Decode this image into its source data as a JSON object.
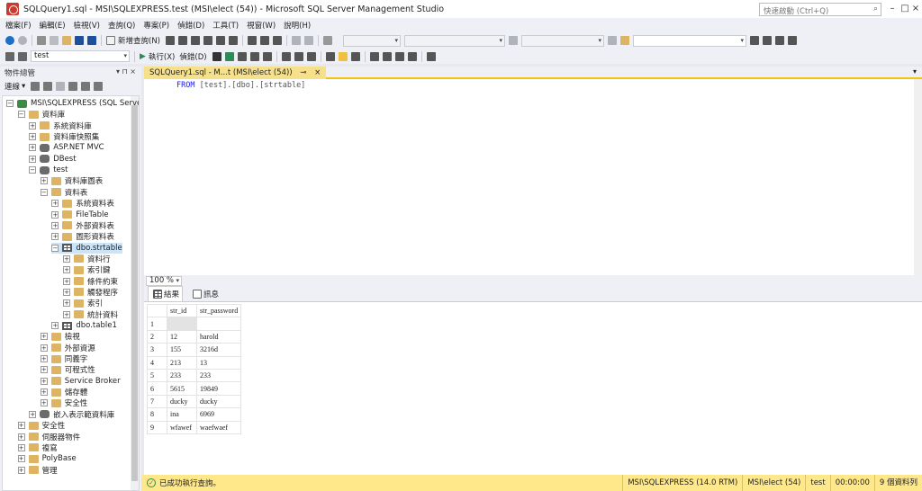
{
  "window": {
    "title": "SQLQuery1.sql - MSI\\SQLEXPRESS.test (MSI\\elect (54)) - Microsoft SQL Server Management Studio",
    "quick_launch_placeholder": "快速啟動 (Ctrl+Q)"
  },
  "menu": [
    "檔案(F)",
    "編輯(E)",
    "檢視(V)",
    "查詢(Q)",
    "專案(P)",
    "偵錯(D)",
    "工具(T)",
    "視窗(W)",
    "說明(H)"
  ],
  "toolbar": {
    "new_query": "新增查詢(N)",
    "database": "test",
    "execute": "執行(X)",
    "debug": "偵錯(D)"
  },
  "object_explorer": {
    "title": "物件總管",
    "connect": "連線",
    "nodes": [
      {
        "label": "MSI\\SQLEXPRESS (SQL Server",
        "expander": "⊟",
        "icon": "server-icon"
      },
      {
        "label": "資料庫",
        "expander": "⊟",
        "icon": "folder-icon"
      },
      {
        "label": "系統資料庫",
        "expander": "⊞",
        "icon": "folder-icon"
      },
      {
        "label": "資料庫快照集",
        "expander": "⊞",
        "icon": "folder-icon"
      },
      {
        "label": "ASP.NET MVC",
        "expander": "⊞",
        "icon": "database-icon"
      },
      {
        "label": "DBest",
        "expander": "⊞",
        "icon": "database-icon"
      },
      {
        "label": "test",
        "expander": "⊟",
        "icon": "database-icon"
      },
      {
        "label": "資料庫圖表",
        "expander": "⊞",
        "icon": "folder-icon"
      },
      {
        "label": "資料表",
        "expander": "⊟",
        "icon": "folder-icon"
      },
      {
        "label": "系統資料表",
        "expander": "⊞",
        "icon": "folder-icon"
      },
      {
        "label": "FileTable",
        "expander": "⊞",
        "icon": "folder-icon"
      },
      {
        "label": "外部資料表",
        "expander": "⊞",
        "icon": "folder-icon"
      },
      {
        "label": "圖形資料表",
        "expander": "⊞",
        "icon": "folder-icon"
      },
      {
        "label": "dbo.strtable",
        "expander": "⊟",
        "icon": "table-icon"
      },
      {
        "label": "資料行",
        "expander": "⊞",
        "icon": "folder-icon"
      },
      {
        "label": "索引鍵",
        "expander": "⊞",
        "icon": "folder-icon"
      },
      {
        "label": "條件約束",
        "expander": "⊞",
        "icon": "folder-icon"
      },
      {
        "label": "觸發程序",
        "expander": "⊞",
        "icon": "folder-icon"
      },
      {
        "label": "索引",
        "expander": "⊞",
        "icon": "folder-icon"
      },
      {
        "label": "統計資料",
        "expander": "⊞",
        "icon": "folder-icon"
      },
      {
        "label": "dbo.table1",
        "expander": "⊞",
        "icon": "table-icon"
      },
      {
        "label": "檢視",
        "expander": "⊞",
        "icon": "folder-icon"
      },
      {
        "label": "外部資源",
        "expander": "⊞",
        "icon": "folder-icon"
      },
      {
        "label": "同義字",
        "expander": "⊞",
        "icon": "folder-icon"
      },
      {
        "label": "可程式性",
        "expander": "⊞",
        "icon": "folder-icon"
      },
      {
        "label": "Service Broker",
        "expander": "⊞",
        "icon": "folder-icon"
      },
      {
        "label": "儲存體",
        "expander": "⊞",
        "icon": "folder-icon"
      },
      {
        "label": "安全性",
        "expander": "⊞",
        "icon": "folder-icon"
      },
      {
        "label": "嵌入表示範資料庫",
        "expander": "⊞",
        "icon": "database-icon"
      },
      {
        "label": "安全性",
        "expander": "⊞",
        "icon": "folder-icon"
      },
      {
        "label": "伺服器物件",
        "expander": "⊞",
        "icon": "folder-icon"
      },
      {
        "label": "複寫",
        "expander": "⊞",
        "icon": "folder-icon"
      },
      {
        "label": "PolyBase",
        "expander": "⊞",
        "icon": "folder-icon"
      },
      {
        "label": "管理",
        "expander": "⊞",
        "icon": "folder-icon"
      }
    ]
  },
  "editor": {
    "tab_label": "SQLQuery1.sql - M...t (MSI\\elect (54))",
    "code_keyword": "FROM",
    "code_rest": " [test].[dbo].[strtable]",
    "zoom": "100 %"
  },
  "results": {
    "tab_results": "結果",
    "tab_messages": "訊息",
    "columns": [
      "str_id",
      "str_password"
    ],
    "rows": [
      [
        "",
        ""
      ],
      [
        "12",
        "harold"
      ],
      [
        "155",
        "3216d"
      ],
      [
        "213",
        "13"
      ],
      [
        "233",
        "233"
      ],
      [
        "5615",
        "19849"
      ],
      [
        "ducky",
        "ducky"
      ],
      [
        "ina",
        "6969"
      ],
      [
        "wfawef",
        "waefwaef"
      ]
    ]
  },
  "status": {
    "message": "已成功執行查詢。",
    "server": "MSI\\SQLEXPRESS (14.0 RTM)",
    "user": "MSI\\elect (54)",
    "database": "test",
    "time": "00:00:00",
    "rows": "9 個資料列"
  }
}
